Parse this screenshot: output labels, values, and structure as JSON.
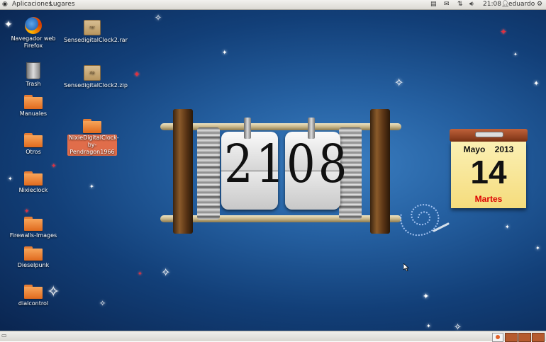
{
  "top_panel": {
    "menu_apps": "Aplicaciones",
    "menu_places": "Lugares",
    "time": "21:08",
    "user": "eduardo"
  },
  "desktop_icons": [
    {
      "label": "Navegador web Firefox",
      "icon": "firefox-icon"
    },
    {
      "label": "Trash",
      "icon": "trash-icon"
    },
    {
      "label": "Manuales",
      "icon": "folder-icon"
    },
    {
      "label": "Otros",
      "icon": "folder-icon"
    },
    {
      "label": "Nixieclock",
      "icon": "folder-icon"
    },
    {
      "label": "Firewalls-Images",
      "icon": "folder-icon"
    },
    {
      "label": "Dieselpunk",
      "icon": "folder-icon"
    },
    {
      "label": "dialcontrol",
      "icon": "folder-icon"
    },
    {
      "label": "SensedigitalClock2.rar",
      "icon": "archive-icon",
      "badge": "rar"
    },
    {
      "label": "SensedigitalClock2.zip",
      "icon": "archive-icon",
      "badge": "zip"
    },
    {
      "label": "NixieDigitalClock-by-Pendragon1966",
      "icon": "folder-icon",
      "selected": true
    }
  ],
  "clock": {
    "hours": "21",
    "minutes": "08"
  },
  "calendar": {
    "month": "Mayo",
    "year": "2013",
    "day": "14",
    "weekday": "Martes"
  },
  "colors": {
    "desktop_bg": "#2560a1",
    "folder": "#f08a3c",
    "selection": "#e06d4a",
    "weekday": "#dd0000"
  }
}
